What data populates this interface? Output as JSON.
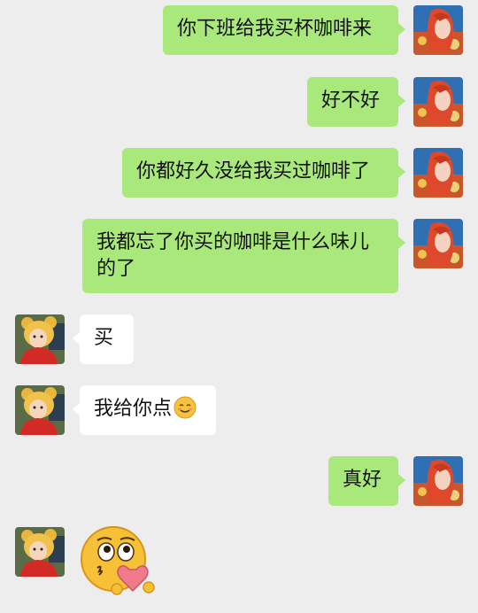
{
  "messages": [
    {
      "from": "me",
      "text": "你下班给我买杯咖啡来"
    },
    {
      "from": "me",
      "text": "好不好"
    },
    {
      "from": "me",
      "text": "你都好久没给我买过咖啡了"
    },
    {
      "from": "me",
      "text": "我都忘了你买的咖啡是什么味儿的了"
    },
    {
      "from": "them",
      "text": "买"
    },
    {
      "from": "them",
      "text": "我给你点"
    },
    {
      "from": "me",
      "text": "真好"
    }
  ],
  "icons": {
    "my_avatar": "red-haired-woman-avatar-icon",
    "their_avatar": "child-in-bear-hat-avatar-icon",
    "inline_emoji": "smiling-face-emoji-icon",
    "sticker": "kissing-face-with-heart-sticker-icon"
  },
  "colors": {
    "background": "#ededed",
    "my_bubble": "#a9e97b",
    "their_bubble": "#ffffff"
  }
}
